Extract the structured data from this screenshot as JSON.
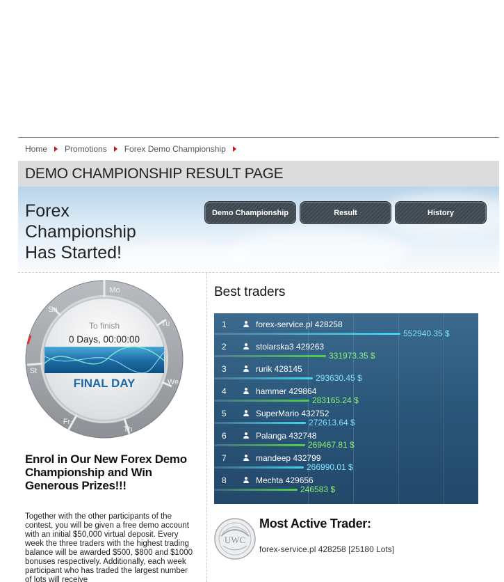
{
  "breadcrumb": {
    "items": [
      "Home",
      "Promotions",
      "Forex Demo Championship"
    ]
  },
  "page_title": "DEMO CHAMPIONSHIP RESULT PAGE",
  "banner": {
    "heading_lines": [
      "Forex",
      "Championship",
      "Has Started!"
    ],
    "tabs": [
      "Demo Championship",
      "Result",
      "History"
    ]
  },
  "countdown": {
    "label": "To finish",
    "value": "0 Days, 00:00:00",
    "status": "FINAL DAY",
    "days": [
      "Mo",
      "Tu",
      "We",
      "Th",
      "Fr",
      "St",
      "Sn"
    ]
  },
  "promo": {
    "heading": "Enrol in Our New Forex Demo Championship and Win Generous Prizes!!!",
    "body": "Together with the other participants of the contest, you will be given a free demo account with an initial $50,000 virtual deposit. Every week the three traders with the highest trading balance will be awarded $500, $800 and $1000 bonuses respectively. Additionally, each week participant who has traded the largest number of lots will receive"
  },
  "best_traders": {
    "title": "Best traders",
    "rows": [
      {
        "rank": "1",
        "name": "forex-service.pl 428258",
        "amount": "552940.35 $",
        "balance": 552940.35
      },
      {
        "rank": "2",
        "name": "stolarska3 429263",
        "amount": "331973.35 $",
        "balance": 331973.35
      },
      {
        "rank": "3",
        "name": "rurik 428145",
        "amount": "293630.45 $",
        "balance": 293630.45
      },
      {
        "rank": "4",
        "name": "hammer 429864",
        "amount": "283165.24 $",
        "balance": 283165.24
      },
      {
        "rank": "5",
        "name": "SuperMario 432752",
        "amount": "272613.64 $",
        "balance": 272613.64
      },
      {
        "rank": "6",
        "name": "Palanga 432748",
        "amount": "269467.81 $",
        "balance": 269467.81
      },
      {
        "rank": "7",
        "name": "mandeep 432799",
        "amount": "266990.01 $",
        "balance": 266990.01
      },
      {
        "rank": "8",
        "name": "Mechta 429656",
        "amount": "246583 $",
        "balance": 246583
      }
    ]
  },
  "most_active": {
    "title": "Most Active Trader:",
    "trader": "forex-service.pl 428258 [25180 Lots]",
    "seal_text": "UWC"
  },
  "colors": {
    "bar_green": "#4fd24a",
    "bar_cyan": "#3fd6f0",
    "amount_green": "#8cf07a",
    "amount_cyan": "#7fe2ff",
    "breadcrumb_arrow": "#c41a1a"
  }
}
